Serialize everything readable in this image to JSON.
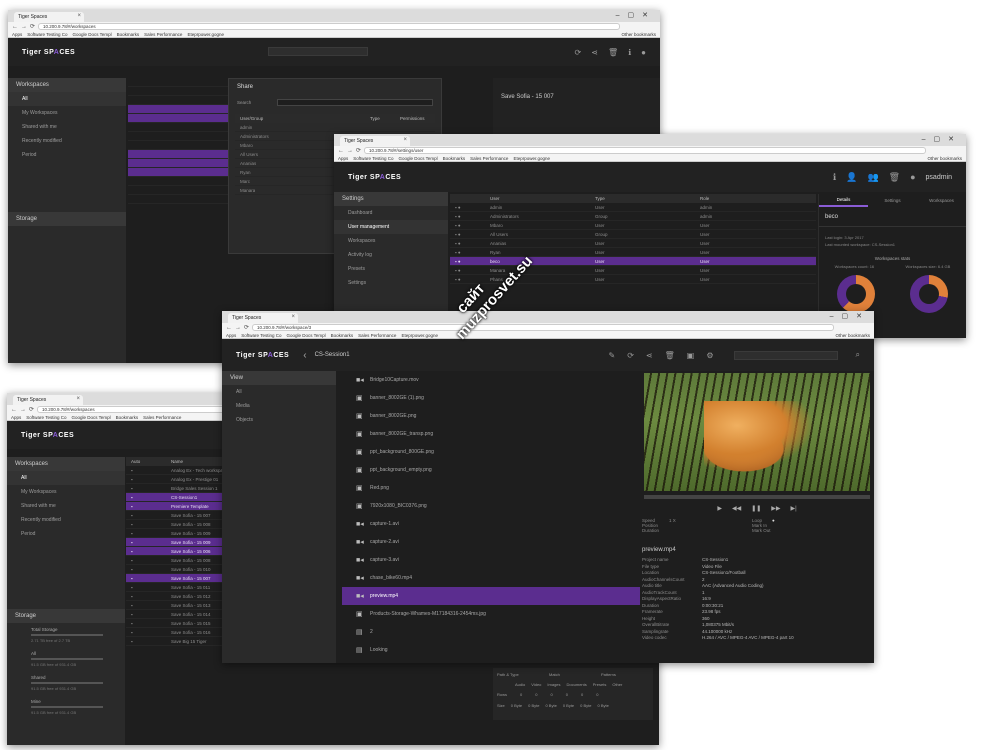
{
  "browser": {
    "tab_title": "Tiger Spaces",
    "bookmarks": [
      "Apps",
      "Software Testing Co",
      "Google Docs Templ",
      "Bookmarks",
      "Sales Performance",
      "Eteprpower.gogne"
    ],
    "other_bookmarks": "Other bookmarks"
  },
  "brand": {
    "logo_pre": "Tiger SP",
    "logo_a": "A",
    "logo_post": "CES"
  },
  "win1": {
    "url": "10.200.9.78/#/workspaces",
    "sidebar_title": "Workspaces",
    "sidebar_items": [
      "All",
      "My Workspaces",
      "Shared with me",
      "Recently modified",
      "Period"
    ],
    "storage_title": "Storage",
    "share_dialog": {
      "title": "Share",
      "search_label": "Search",
      "col_user": "User/Group",
      "col_type": "Type",
      "col_perm": "Permissions",
      "users": [
        "admin",
        "Administrators",
        "Mbaro",
        "All Users",
        "Ananias",
        "Ryan",
        "Marc",
        "Manara"
      ]
    },
    "right_title": "Save Sofia - 15 007"
  },
  "win2": {
    "url": "10.200.9.78/#/settings/user",
    "user": "psadmin",
    "sidebar_title": "Settings",
    "sidebar_items": [
      "Dashboard",
      "User management",
      "Workspaces",
      "Activity log",
      "Presets",
      "Settings"
    ],
    "columns": [
      "User",
      "Type",
      "Role"
    ],
    "users": [
      {
        "name": "admin",
        "type": "User",
        "role": "admin"
      },
      {
        "name": "Administrators",
        "type": "Group",
        "role": "admin"
      },
      {
        "name": "Mbaro",
        "type": "User",
        "role": "User"
      },
      {
        "name": "All Users",
        "type": "Group",
        "role": "User"
      },
      {
        "name": "Ananias",
        "type": "User",
        "role": "User"
      },
      {
        "name": "Ryan",
        "type": "User",
        "role": "User"
      },
      {
        "name": "beco",
        "type": "User",
        "role": "User"
      },
      {
        "name": "Manara",
        "type": "User",
        "role": "User"
      },
      {
        "name": "Phans",
        "type": "User",
        "role": "User"
      }
    ],
    "selected_index": 6,
    "detail_tabs": [
      "Details",
      "Settings",
      "Workspaces"
    ],
    "detail_name": "beco",
    "last_login": "Last login: 3 Apr 2017",
    "last_ws": "Last mounted workspace: CS-Session1",
    "stats_title": "Workspaces stats",
    "stat1": "Workspaces count: 16",
    "stat2": "Workspaces size: 6.4 GB",
    "accent": "#5b2d8f",
    "donut_orange": "#e0813a",
    "donut_purple": "#5b2d8f"
  },
  "win3": {
    "url": "10.200.9.78/#/workspaces",
    "sidebar_title": "Workspaces",
    "sidebar_items": [
      "All",
      "My Workspaces",
      "Shared with me",
      "Recently modified",
      "Period"
    ],
    "storage_title": "Storage",
    "storage_items": [
      {
        "name": "Total Storage",
        "info": "2.71 TB free of 2.7 TB"
      },
      {
        "name": "All",
        "info": "91.5 GB free of 931.4 GB"
      },
      {
        "name": "Shared",
        "info": "91.5 GB free of 931.4 GB"
      },
      {
        "name": "Mine",
        "info": "91.5 GB free of 931.4 GB"
      }
    ],
    "columns": [
      "Auto",
      "Name"
    ],
    "rows": [
      "Analog Ex - Tech workspace",
      "Analog Ex - Prestige 01",
      "Bridge Sales Session 1",
      "CS-Session1",
      "Premiere Template",
      "Save Sofia - 15 007",
      "Save Sofia - 15 008",
      "Save Sofia - 15 009",
      "Save Sofia - 15 009",
      "Save Sofia - 15 006",
      "Save Sofia - 15 008",
      "Save Sofia - 15 010",
      "Save Sofia - 15 007",
      "Save Sofia - 15 011",
      "Save Sofia - 15 012",
      "Save Sofia - 15 013",
      "Save Sofia - 15 014",
      "Save Sofia - 15 015",
      "Save Sofia - 15 016",
      "Save Big 15 Tiger"
    ],
    "selected_rows": [
      3,
      4,
      8,
      9,
      12
    ],
    "bottom_table": {
      "headers": [
        "Audio",
        "Video",
        "Images",
        "Documents",
        "Presets",
        "Other"
      ],
      "group_headers": [
        "Path & Type",
        "Match",
        "Patterns"
      ],
      "row_labels": [
        "Rows",
        "Size"
      ],
      "counts": [
        "0",
        "0",
        "0",
        "0",
        "0",
        "0"
      ],
      "sizes": [
        "0 Byte",
        "0 Byte",
        "0 Byte",
        "0 Byte",
        "0 Byte",
        "0 Byte"
      ]
    }
  },
  "win4": {
    "url": "10.200.9.78/#/workspace/3",
    "title": "CS-Session1",
    "sidebar_title": "View",
    "sidebar_items": [
      "All",
      "Media",
      "Objects"
    ],
    "files": [
      {
        "icon": "video",
        "name": "Bridge10Capture.mov"
      },
      {
        "icon": "image",
        "name": "banner_8002GE (1).png"
      },
      {
        "icon": "image",
        "name": "banner_8002GE.png"
      },
      {
        "icon": "image",
        "name": "banner_8002GE_transp.png"
      },
      {
        "icon": "image",
        "name": "ppt_background_800GE.png"
      },
      {
        "icon": "image",
        "name": "ppt_background_empty.png"
      },
      {
        "icon": "image",
        "name": "Red.png"
      },
      {
        "icon": "image",
        "name": "7920x1080_BIC0376.png"
      },
      {
        "icon": "video",
        "name": "capture-1.avi"
      },
      {
        "icon": "video",
        "name": "capture-2.avi"
      },
      {
        "icon": "video",
        "name": "capture-3.avi"
      },
      {
        "icon": "video",
        "name": "chase_bike60.mp4"
      },
      {
        "icon": "video",
        "name": "preview.mp4"
      },
      {
        "icon": "image",
        "name": "Products-Storage-Whames-M17184316-2454ms.jpg"
      },
      {
        "icon": "doc",
        "name": "2"
      },
      {
        "icon": "doc",
        "name": "Looking"
      }
    ],
    "selected_index": 12,
    "player": {
      "speed_label": "Speed",
      "speed_value": "1 X",
      "position_label": "Position",
      "duration_label": "Duration",
      "loop_label": "Loop",
      "mark_in_label": "Mark In",
      "mark_out_label": "Mark Out"
    },
    "file_title": "preview.mp4",
    "meta": [
      {
        "k": "Project name",
        "v": "CS-Session1"
      },
      {
        "k": "File type",
        "v": "Video File"
      },
      {
        "k": "Location",
        "v": "CS-Session1/Football"
      },
      {
        "k": "AudioChannelsCount",
        "v": "2"
      },
      {
        "k": "Audio title",
        "v": "AAC (Advanced Audio Coding)"
      },
      {
        "k": "AudioTrackCount",
        "v": "1"
      },
      {
        "k": "DisplayAspectRatio",
        "v": "16:9"
      },
      {
        "k": "Duration",
        "v": "0:00:30:21"
      },
      {
        "k": "Framerate",
        "v": "23.98 fps"
      },
      {
        "k": "Height",
        "v": "360"
      },
      {
        "k": "OverallBitrate",
        "v": "1,080375 Mbit/s"
      },
      {
        "k": "Samplingrate",
        "v": "44.100000 kHz"
      },
      {
        "k": "Video codec",
        "v": "H.264 / AVC / MPEG-4 AVC / MPEG-4 part 10"
      }
    ]
  },
  "watermark": {
    "line1": "сайт",
    "line2": "muzprosvet.su"
  }
}
